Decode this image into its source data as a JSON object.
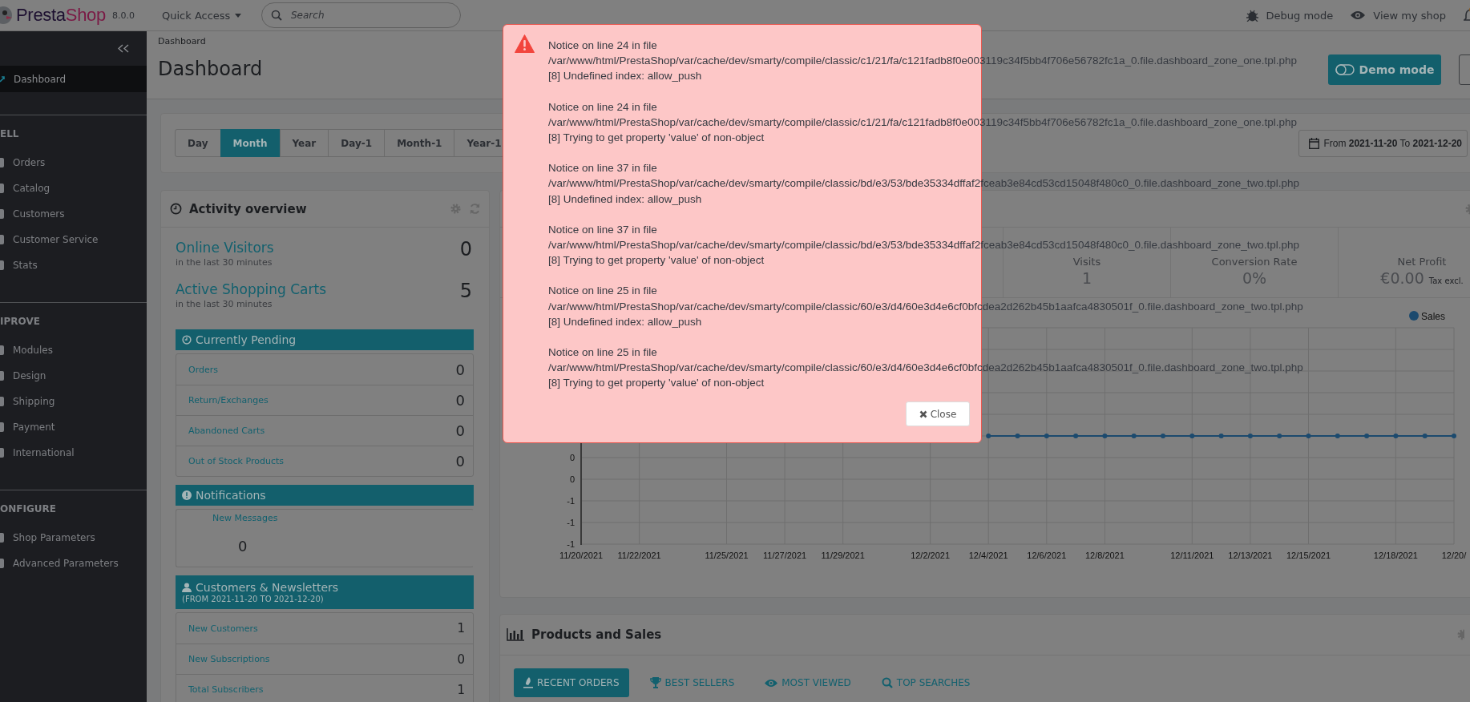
{
  "header": {
    "logo_parts": [
      "Presta",
      "Shop"
    ],
    "version": "8.0.0",
    "quick_access": "Quick Access",
    "search": {
      "placeholder": "Search"
    },
    "links": [
      {
        "kind": "debug",
        "label": "Debug mode"
      },
      {
        "kind": "view",
        "label": "View my shop"
      }
    ]
  },
  "sidebar": {
    "top_items": [
      {
        "label": "Dashboard",
        "selected": true
      }
    ],
    "sections": [
      {
        "title": "ELL",
        "items": [
          {
            "label": "Orders",
            "selected": false
          },
          {
            "label": "Catalog",
            "selected": false
          },
          {
            "label": "Customers",
            "selected": false
          },
          {
            "label": "Customer Service",
            "selected": false
          },
          {
            "label": "Stats",
            "selected": false
          }
        ]
      },
      {
        "title": "IPROVE",
        "items": [
          {
            "label": "Modules",
            "selected": false
          },
          {
            "label": "Design",
            "selected": false
          },
          {
            "label": "Shipping",
            "selected": false
          },
          {
            "label": "Payment",
            "selected": false
          },
          {
            "label": "International",
            "selected": false
          }
        ]
      },
      {
        "title": "ONFIGURE",
        "items": [
          {
            "label": "Shop Parameters",
            "selected": false
          },
          {
            "label": "Advanced Parameters",
            "selected": false
          }
        ]
      }
    ]
  },
  "breadcrumb": "Dashboard",
  "page_title": "Dashboard",
  "toolbar_buttons": [
    {
      "kind": "demo",
      "label": "Demo mode"
    },
    {
      "kind": "help"
    }
  ],
  "period_tabs": [
    {
      "label": "Day",
      "selected": false
    },
    {
      "label": "Month",
      "selected": true
    },
    {
      "label": "Year",
      "selected": false
    },
    {
      "label": "Day-1",
      "selected": false
    },
    {
      "label": "Month-1",
      "selected": false
    },
    {
      "label": "Year-1",
      "selected": false
    }
  ],
  "date_range": "From **2021-11-20** To **2021-12-20**",
  "activity": {
    "title": "Activity overview",
    "stats": [
      {
        "label": "Online Visitors",
        "note": "in the last 30 minutes",
        "value": "0"
      },
      {
        "label": "Active Shopping Carts",
        "note": "in the last 30 minutes",
        "value": "5"
      }
    ],
    "pending": {
      "title": "Currently Pending",
      "rows": [
        {
          "label": "Orders",
          "value": "0"
        },
        {
          "label": "Return/Exchanges",
          "value": "0"
        },
        {
          "label": "Abandoned Carts",
          "value": "0"
        },
        {
          "label": "Out of Stock Products",
          "value": "0"
        }
      ]
    },
    "notifications": {
      "title": "Notifications",
      "label": "New Messages",
      "value": "0"
    },
    "customers": {
      "title": "Customers & Newsletters",
      "subtitle": "(FROM 2021-11-20 TO 2021-12-20)",
      "rows": [
        {
          "label": "New Customers",
          "value": "1"
        },
        {
          "label": "New Subscriptions",
          "value": "0"
        },
        {
          "label": "Total Subscribers",
          "value": "1"
        }
      ]
    }
  },
  "sales_panel": {
    "kpis": [
      {
        "label": "Visits",
        "value": "1"
      },
      {
        "label": "Conversion Rate",
        "value": "0%"
      },
      {
        "label": "Net Profit",
        "value": "€0.00",
        "note": "Tax excl."
      }
    ],
    "chart_data": {
      "type": "line",
      "categories": [
        "11/20/2021",
        null,
        "11/22/2021",
        null,
        null,
        "11/25/2021",
        null,
        "11/27/2021",
        null,
        "11/29/2021",
        null,
        null,
        "12/2/2021",
        null,
        "12/4/2021",
        null,
        "12/6/2021",
        null,
        "12/8/2021",
        null,
        null,
        "12/11/2021",
        null,
        "12/13/2021",
        null,
        "12/15/2021",
        null,
        null,
        "12/18/2021",
        null,
        "12/20/"
      ],
      "ylim": [
        -1,
        1
      ],
      "yticks": [
        {
          "value": -0.2,
          "label": "0"
        },
        {
          "value": -0.4,
          "label": "0"
        },
        {
          "value": -0.6,
          "label": "-1"
        },
        {
          "value": -0.8,
          "label": "-1"
        },
        {
          "value": -1,
          "label": "-1"
        }
      ],
      "grid": true,
      "series": [
        {
          "name": "Sales",
          "color": "#1c4a6e",
          "marker": "circle",
          "values": [
            null,
            null,
            null,
            null,
            null,
            null,
            null,
            null,
            null,
            null,
            null,
            null,
            null,
            null,
            0,
            0,
            0,
            0,
            0,
            0,
            0,
            0,
            0,
            0,
            0,
            0,
            0,
            0,
            0,
            0,
            0
          ]
        }
      ]
    }
  },
  "products_panel": {
    "title": "Products and Sales",
    "tabs": [
      {
        "kind": "orders",
        "label": "RECENT ORDERS",
        "selected": true
      },
      {
        "kind": "trophy",
        "label": "BEST SELLERS",
        "selected": false
      },
      {
        "kind": "eye",
        "label": "MOST VIEWED",
        "selected": false
      },
      {
        "kind": "search",
        "label": "TOP SEARCHES",
        "selected": false
      }
    ]
  },
  "modal": {
    "notices": [
      {
        "heading": "Notice on line 24 in file",
        "path": "/var/www/html/PrestaShop/var/cache/dev/smarty/compile/classic/c1/21/fa/c121fadb8f0e003119c34f5bb4f706e56782fc1a_0.file.dashboard_zone_one.tpl.php",
        "message": "[8] Undefined index: allow_push"
      },
      {
        "heading": "Notice on line 24 in file",
        "path": "/var/www/html/PrestaShop/var/cache/dev/smarty/compile/classic/c1/21/fa/c121fadb8f0e003119c34f5bb4f706e56782fc1a_0.file.dashboard_zone_one.tpl.php",
        "message": "[8] Trying to get property 'value' of non-object"
      },
      {
        "heading": "Notice on line 37 in file",
        "path": "/var/www/html/PrestaShop/var/cache/dev/smarty/compile/classic/bd/e3/53/bde35334dffaf2fceab3e84cd53cd15048f480c0_0.file.dashboard_zone_two.tpl.php",
        "message": "[8] Undefined index: allow_push"
      },
      {
        "heading": "Notice on line 37 in file",
        "path": "/var/www/html/PrestaShop/var/cache/dev/smarty/compile/classic/bd/e3/53/bde35334dffaf2fceab3e84cd53cd15048f480c0_0.file.dashboard_zone_two.tpl.php",
        "message": "[8] Trying to get property 'value' of non-object"
      },
      {
        "heading": "Notice on line 25 in file",
        "path": "/var/www/html/PrestaShop/var/cache/dev/smarty/compile/classic/60/e3/d4/60e3d4e6cf0bfcdea2d262b45b1aafca4830501f_0.file.dashboard_zone_two.tpl.php",
        "message": "[8] Undefined index: allow_push"
      },
      {
        "heading": "Notice on line 25 in file",
        "path": "/var/www/html/PrestaShop/var/cache/dev/smarty/compile/classic/60/e3/d4/60e3d4e6cf0bfcdea2d262b45b1aafca4830501f_0.file.dashboard_zone_two.tpl.php",
        "message": "[8] Trying to get property 'value' of non-object"
      }
    ],
    "close": "Close"
  }
}
